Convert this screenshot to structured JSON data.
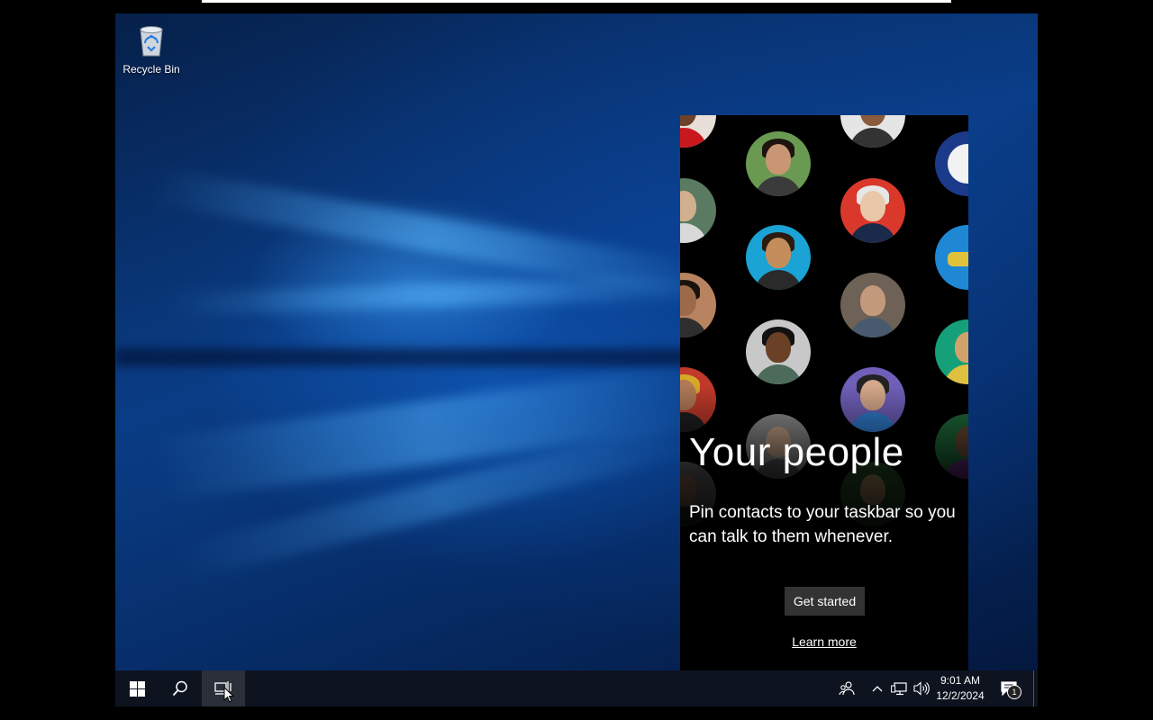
{
  "desktop": {
    "recycle_bin_label": "Recycle Bin"
  },
  "people_panel": {
    "title": "Your people",
    "description": "Pin contacts to your taskbar so you can talk to them whenever.",
    "get_started_label": "Get started",
    "learn_more_label": "Learn more"
  },
  "taskbar": {
    "clock_time": "9:01 AM",
    "clock_date": "12/2/2024",
    "notification_count": "1",
    "icons": [
      "windows-start-icon",
      "search-icon",
      "task-view-icon",
      "people-icon",
      "chevron-up-icon",
      "network-icon",
      "volume-icon",
      "action-center-icon"
    ]
  },
  "colors": {
    "accent": "#0a63c9",
    "taskbar": "#0e1320",
    "panel_background": "#000000",
    "button_background": "#333333"
  }
}
